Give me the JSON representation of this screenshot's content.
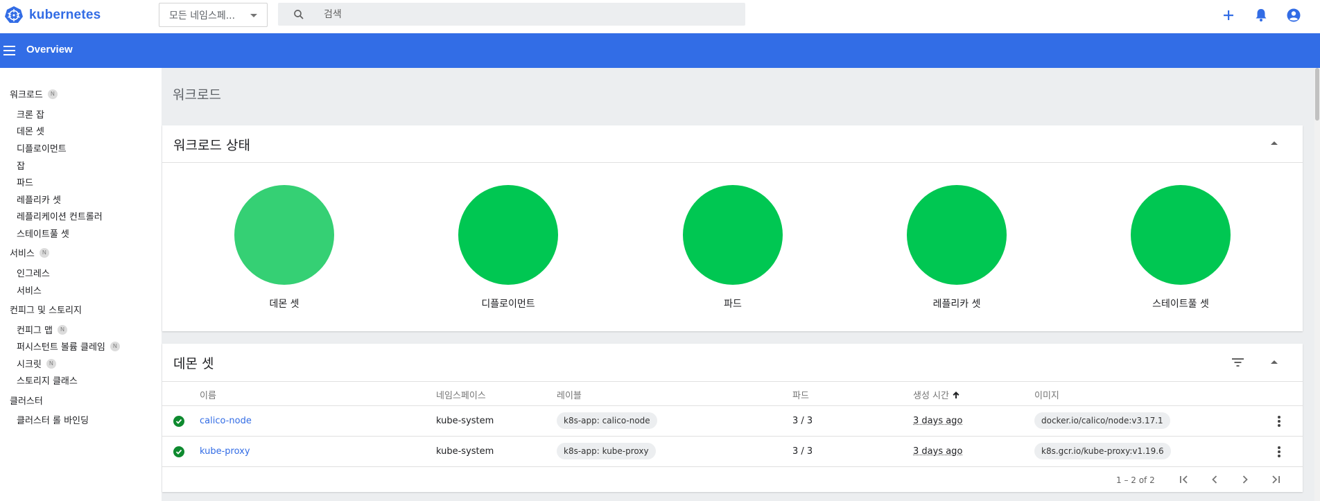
{
  "app": {
    "name": "kubernetes"
  },
  "topbar": {
    "namespace_selected": "모든 네임스페...",
    "search_placeholder": "검색",
    "icons": [
      "plus-icon",
      "bell-icon",
      "account-circle-icon"
    ]
  },
  "header": {
    "title": "Overview"
  },
  "sidebar": {
    "sections": [
      {
        "label": "워크로드",
        "badge": "N"
      },
      {
        "label": "서비스",
        "badge": "N"
      },
      {
        "label": "컨피그 및 스토리지",
        "badge": ""
      },
      {
        "label": "클러스터",
        "badge": ""
      }
    ],
    "workloads": [
      "크론 잡",
      "데몬 셋",
      "디플로이먼트",
      "잡",
      "파드",
      "레플리카 셋",
      "레플리케이션 컨트롤러",
      "스테이트풀 셋"
    ],
    "services": [
      "인그레스",
      "서비스"
    ],
    "config": [
      {
        "label": "컨피그 맵",
        "badge": "N"
      },
      {
        "label": "퍼시스턴트 볼륨 클레임",
        "badge": "N"
      },
      {
        "label": "시크릿",
        "badge": "N"
      },
      {
        "label": "스토리지 클래스",
        "badge": ""
      }
    ],
    "cluster": [
      "클러스터 롤 바인딩"
    ]
  },
  "main": {
    "page_title": "워크로드",
    "status_card": {
      "title": "워크로드 상태",
      "items": [
        {
          "label": "데몬 셋",
          "color": "#35d074"
        },
        {
          "label": "디플로이먼트",
          "color": "#00c752"
        },
        {
          "label": "파드",
          "color": "#00c752"
        },
        {
          "label": "레플리카 셋",
          "color": "#00c752"
        },
        {
          "label": "스테이트풀 셋",
          "color": "#00c752"
        }
      ]
    },
    "daemonset_card": {
      "title": "데몬 셋",
      "columns": [
        "이름",
        "네임스페이스",
        "레이블",
        "파드",
        "생성 시간",
        "이미지"
      ],
      "sort_column": "생성 시간",
      "rows": [
        {
          "name": "calico-node",
          "namespace": "kube-system",
          "label": "k8s-app: calico-node",
          "pods": "3 / 3",
          "created": "3 days ago",
          "image": "docker.io/calico/node:v3.17.1",
          "status": "running"
        },
        {
          "name": "kube-proxy",
          "namespace": "kube-system",
          "label": "k8s-app: kube-proxy",
          "pods": "3 / 3",
          "created": "3 days ago",
          "image": "k8s.gcr.io/kube-proxy:v1.19.6",
          "status": "running"
        }
      ],
      "pagination": "1 – 2 of 2"
    }
  },
  "colors": {
    "brand": "#326ce5",
    "header": "#326de6",
    "ok": "#0e8a2f"
  }
}
